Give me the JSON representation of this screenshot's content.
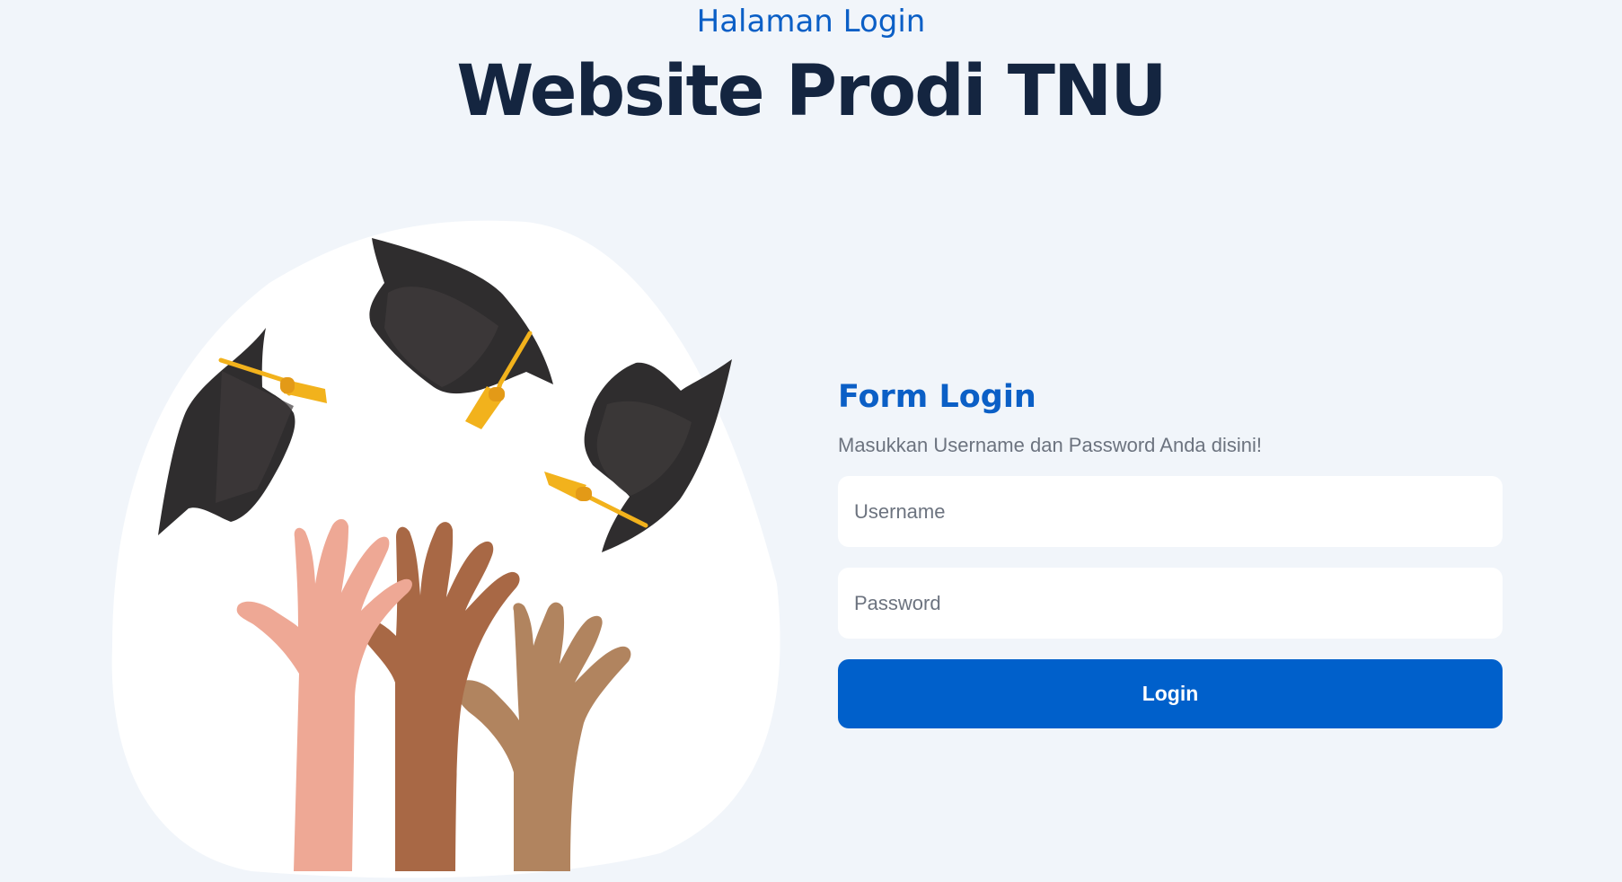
{
  "header": {
    "eyebrow": "Halaman Login",
    "title": "Website Prodi TNU"
  },
  "illustration": {
    "name": "graduation-caps-and-raised-hands",
    "colors": {
      "blob": "#ffffff",
      "cap": "#2f2d2e",
      "tassel": "#f2b21c",
      "hand_light": "#eea895",
      "hand_dark": "#a86845",
      "hand_medium": "#b1845f"
    }
  },
  "login_form": {
    "title": "Form Login",
    "subtitle": "Masukkan Username dan Password Anda disini!",
    "username_placeholder": "Username",
    "username_value": "",
    "password_placeholder": "Password",
    "password_value": "",
    "submit_label": "Login"
  },
  "colors": {
    "background": "#f1f5fa",
    "primary": "#0060cb",
    "heading_blue": "#0b5fc6",
    "title_navy": "#142540",
    "muted_text": "#6c737f"
  }
}
